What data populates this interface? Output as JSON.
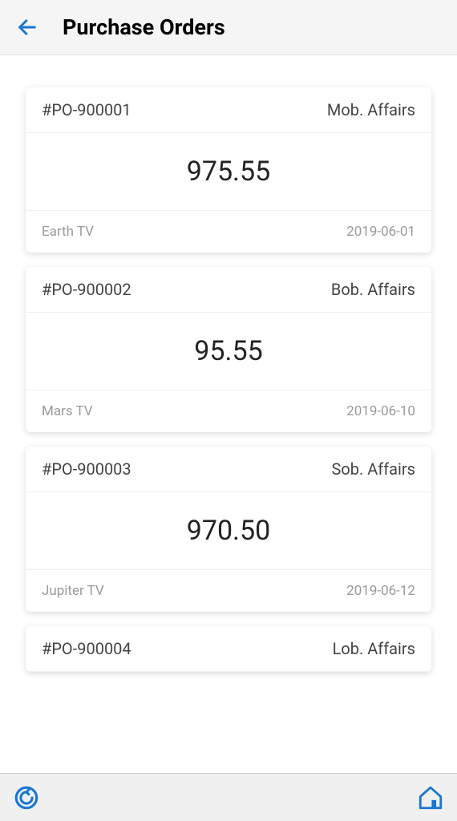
{
  "header": {
    "title": "Purchase Orders"
  },
  "orders": [
    {
      "id": "#PO-900001",
      "party": "Mob. Affairs",
      "amount": "975.55",
      "vendor": "Earth TV",
      "date": "2019-06-01"
    },
    {
      "id": "#PO-900002",
      "party": "Bob. Affairs",
      "amount": "95.55",
      "vendor": "Mars TV",
      "date": "2019-06-10"
    },
    {
      "id": "#PO-900003",
      "party": "Sob. Affairs",
      "amount": "970.50",
      "vendor": "Jupiter TV",
      "date": "2019-06-12"
    },
    {
      "id": "#PO-900004",
      "party": "Lob. Affairs",
      "amount": "",
      "vendor": "",
      "date": ""
    }
  ]
}
